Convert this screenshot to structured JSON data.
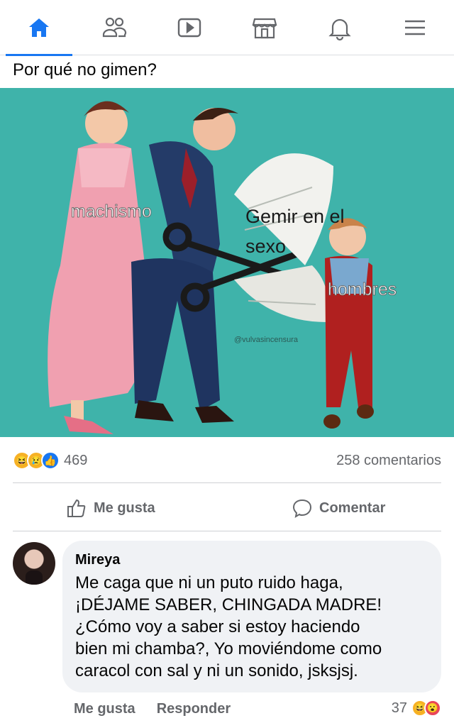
{
  "nav": {
    "tabs": [
      {
        "icon": "home-icon",
        "active": true
      },
      {
        "icon": "friends-icon",
        "active": false
      },
      {
        "icon": "watch-icon",
        "active": false
      },
      {
        "icon": "marketplace-icon",
        "active": false
      },
      {
        "icon": "notifications-icon",
        "active": false
      },
      {
        "icon": "menu-icon",
        "active": false
      }
    ],
    "accent": "#1877f2"
  },
  "post": {
    "text": "Por qué no gimen?",
    "image": {
      "labels": {
        "machismo": "machismo",
        "gemir": "Gemir en el",
        "sexo": "sexo",
        "hombres": "hombres",
        "watermark": "@vulvasincensura"
      }
    },
    "reactions": [
      "haha-icon",
      "sad-icon",
      "like-icon"
    ],
    "reaction_count": "469",
    "comments_count": "258 comentarios",
    "actions": {
      "like": "Me gusta",
      "comment": "Comentar"
    }
  },
  "comment": {
    "author": "Mireya",
    "text": "Me caga que ni un puto ruido haga,\n¡DÉJAME SABER, CHINGADA MADRE!\n¿Cómo voy a saber si estoy haciendo\nbien mi chamba?, Yo moviéndome como\ncaracol con sal y ni un sonido, jsksjsj.",
    "like_label": "Me gusta",
    "reply_label": "Responder",
    "reaction_count": "37"
  }
}
